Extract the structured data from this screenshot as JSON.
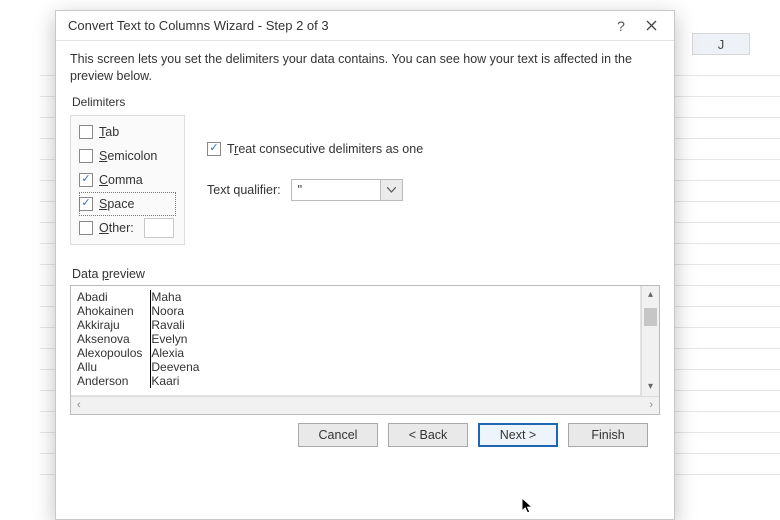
{
  "sheet": {
    "visible_col_header": "J"
  },
  "dialog": {
    "title": "Convert Text to Columns Wizard - Step 2 of 3",
    "help_symbol": "?",
    "intro": "This screen lets you set the delimiters your data contains.  You can see how your text is affected in the preview below.",
    "delimiters": {
      "heading": "Delimiters",
      "tab": {
        "label_u": "T",
        "label_rest": "ab",
        "checked": false
      },
      "semicolon": {
        "label_u": "S",
        "label_pre": "",
        "label_rest": "emicolon",
        "checked": false
      },
      "comma": {
        "label_u": "C",
        "label_rest": "omma",
        "checked": true
      },
      "space": {
        "label_u": "S",
        "label_rest": "pace",
        "checked": true,
        "focused": true
      },
      "other": {
        "label_u": "O",
        "label_rest": "ther:",
        "checked": false,
        "value": ""
      }
    },
    "treat_consecutive": {
      "label_pre": "T",
      "label_u": "r",
      "label_rest": "eat consecutive delimiters as one",
      "checked": true
    },
    "text_qualifier": {
      "label": "Text qualifier:",
      "value": "\""
    },
    "preview": {
      "heading_pre": "Data ",
      "heading_u": "p",
      "heading_rest": "review",
      "rows": [
        [
          "Abadi",
          "Maha"
        ],
        [
          "Ahokainen",
          "Noora"
        ],
        [
          "Akkiraju",
          "Ravali"
        ],
        [
          "Aksenova",
          "Evelyn"
        ],
        [
          "Alexopoulos",
          "Alexia"
        ],
        [
          "Allu",
          "Deevena"
        ],
        [
          "Anderson",
          "Kaari"
        ]
      ]
    },
    "buttons": {
      "cancel": "Cancel",
      "back": "< Back",
      "next": "Next >",
      "finish": "Finish"
    }
  }
}
